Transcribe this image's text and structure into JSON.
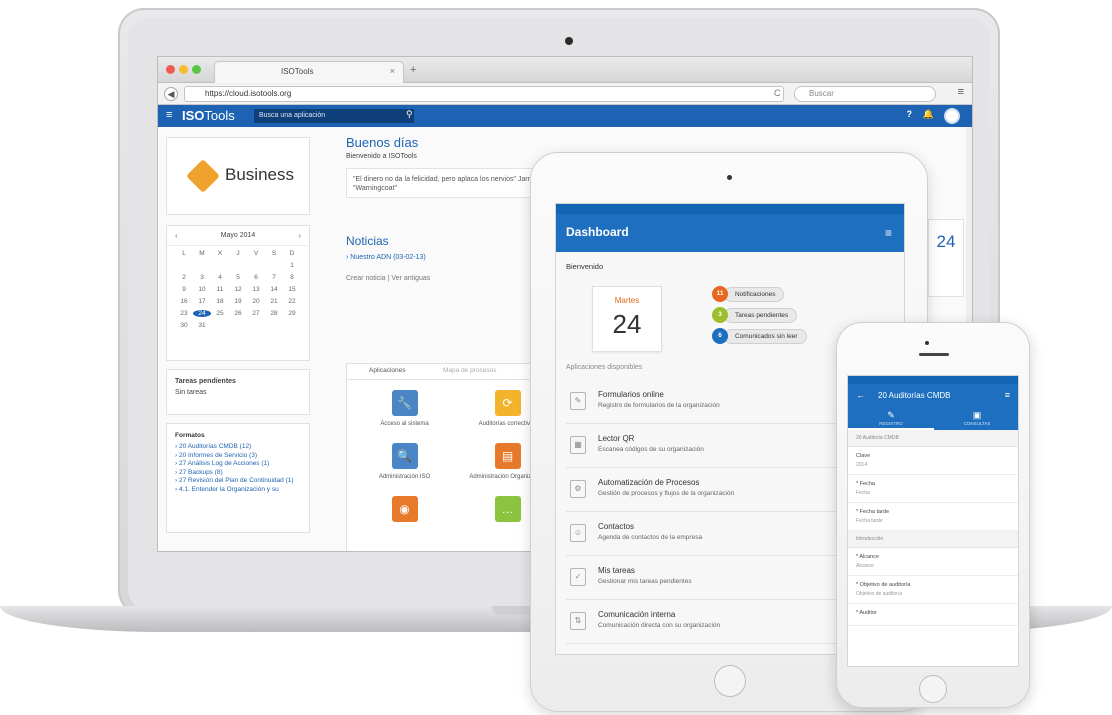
{
  "browser": {
    "tab_title": "ISOTools",
    "tab_close": "×",
    "tab_new": "+",
    "url": "https://cloud.isotools.org",
    "reload": "C",
    "search_placeholder": "Buscar",
    "menu": "≡"
  },
  "app": {
    "logo_bold": "ISO",
    "logo_regular": "Tools",
    "search_placeholder": "Busca una aplicación",
    "header_icons": {
      "help": "?",
      "notifications": "🔔"
    },
    "business_label": "Business"
  },
  "calendar": {
    "title": "Mayo 2014",
    "prev": "‹",
    "next": "›",
    "weekdays": [
      "L",
      "M",
      "X",
      "J",
      "V",
      "S",
      "D"
    ],
    "days": [
      "",
      "",
      "",
      "",
      "",
      "",
      "1",
      "2",
      "3",
      "4",
      "5",
      "6",
      "7",
      "8",
      "9",
      "10",
      "11",
      "12",
      "13",
      "14",
      "15",
      "16",
      "17",
      "18",
      "19",
      "20",
      "21",
      "22",
      "23",
      "24",
      "25",
      "26",
      "27",
      "28",
      "29",
      "30",
      "31"
    ],
    "today": "24"
  },
  "tasks": {
    "title": "Tareas pendientes",
    "empty": "Sin tareas"
  },
  "formats": {
    "title": "Formatos",
    "items": [
      "20 Auditorías CMDB (12)",
      "20 Informes de Servicio (3)",
      "27 Análisis Log de Acciones (1)",
      "27 Backups (8)",
      "27 Revisión del Plan de Continuidad (1)",
      "4.1. Entender la Organización y su"
    ]
  },
  "main": {
    "greeting": "Buenos días",
    "welcome": "Bienvenido a ISOTools",
    "quote": "\"El dinero no da la felicidad, pero aplaca los nervios\" Jarro, como decía el jubilado, \"Warningcoat\"",
    "news_title": "Noticias",
    "news_item": "Nuestro ADN (03-02-13)",
    "news_more": "Crear noticia | Ver antiguas",
    "apps_tabs": [
      "Aplicaciones",
      "Mapa de procesos"
    ],
    "apps": [
      {
        "label": "Acceso al sistema",
        "icon": "🔧",
        "color": "#4a86c5"
      },
      {
        "label": "Auditorías correctivas",
        "icon": "⟳",
        "color": "#f3b32a"
      },
      {
        "label": "Administración ISO",
        "icon": "🔍",
        "color": "#4a86c5"
      },
      {
        "label": "Administración Organización",
        "icon": "▤",
        "color": "#e77a2a"
      },
      {
        "label": "",
        "icon": "◉",
        "color": "#e77a2a"
      },
      {
        "label": "",
        "icon": "…",
        "color": "#8cc43f"
      }
    ],
    "right_calendar_day": "24"
  },
  "tablet": {
    "title": "Dashboard",
    "menu_icon": "≡",
    "welcome": "Bienvenido",
    "date_month": "Martes",
    "date_day": "24",
    "pills": [
      {
        "count": "11",
        "label": "Notificaciones",
        "color": "#e9671e"
      },
      {
        "count": "3",
        "label": "Tareas pendientes",
        "color": "#9bbf2d"
      },
      {
        "count": "6",
        "label": "Comunicados sin leer",
        "color": "#1e6fc0"
      }
    ],
    "section_label": "Aplicaciones disponibles",
    "apps": [
      {
        "title": "Formularios online",
        "subtitle": "Registro de formularios de la organización",
        "icon": "✎"
      },
      {
        "title": "Lector QR",
        "subtitle": "Escanea códigos de su organización",
        "icon": "▦"
      },
      {
        "title": "Automatización de Procesos",
        "subtitle": "Gestión de procesos y flujos de la organización",
        "icon": "⚙"
      },
      {
        "title": "Contactos",
        "subtitle": "Agenda de contactos de la empresa",
        "icon": "☺"
      },
      {
        "title": "Mis tareas",
        "subtitle": "Gestionar mis tareas pendientes",
        "icon": "✓"
      },
      {
        "title": "Comunicación interna",
        "subtitle": "Comunicación directa con su organización",
        "icon": "⇅"
      }
    ]
  },
  "phone": {
    "title": "20 Auditorías CMDB",
    "back": "←",
    "menu": "≡",
    "tabs": [
      {
        "label": "REGISTRO",
        "icon": "✎"
      },
      {
        "label": "CONSULTAS",
        "icon": "▣"
      }
    ],
    "crumb": "20 Auditoría CMDB",
    "fields": [
      {
        "label": "Clave",
        "value": "2014"
      },
      {
        "label": "* Fecha",
        "value": "Fecha"
      },
      {
        "label": "* Fecha tarde",
        "value": "Fecha tarde"
      }
    ],
    "section": "Introducción",
    "fields2": [
      {
        "label": "* Alcance",
        "value": "Alcance"
      },
      {
        "label": "* Objetivo de auditoría",
        "value": "Objetivo de auditoría"
      },
      {
        "label": "* Auditor",
        "value": ""
      }
    ]
  }
}
